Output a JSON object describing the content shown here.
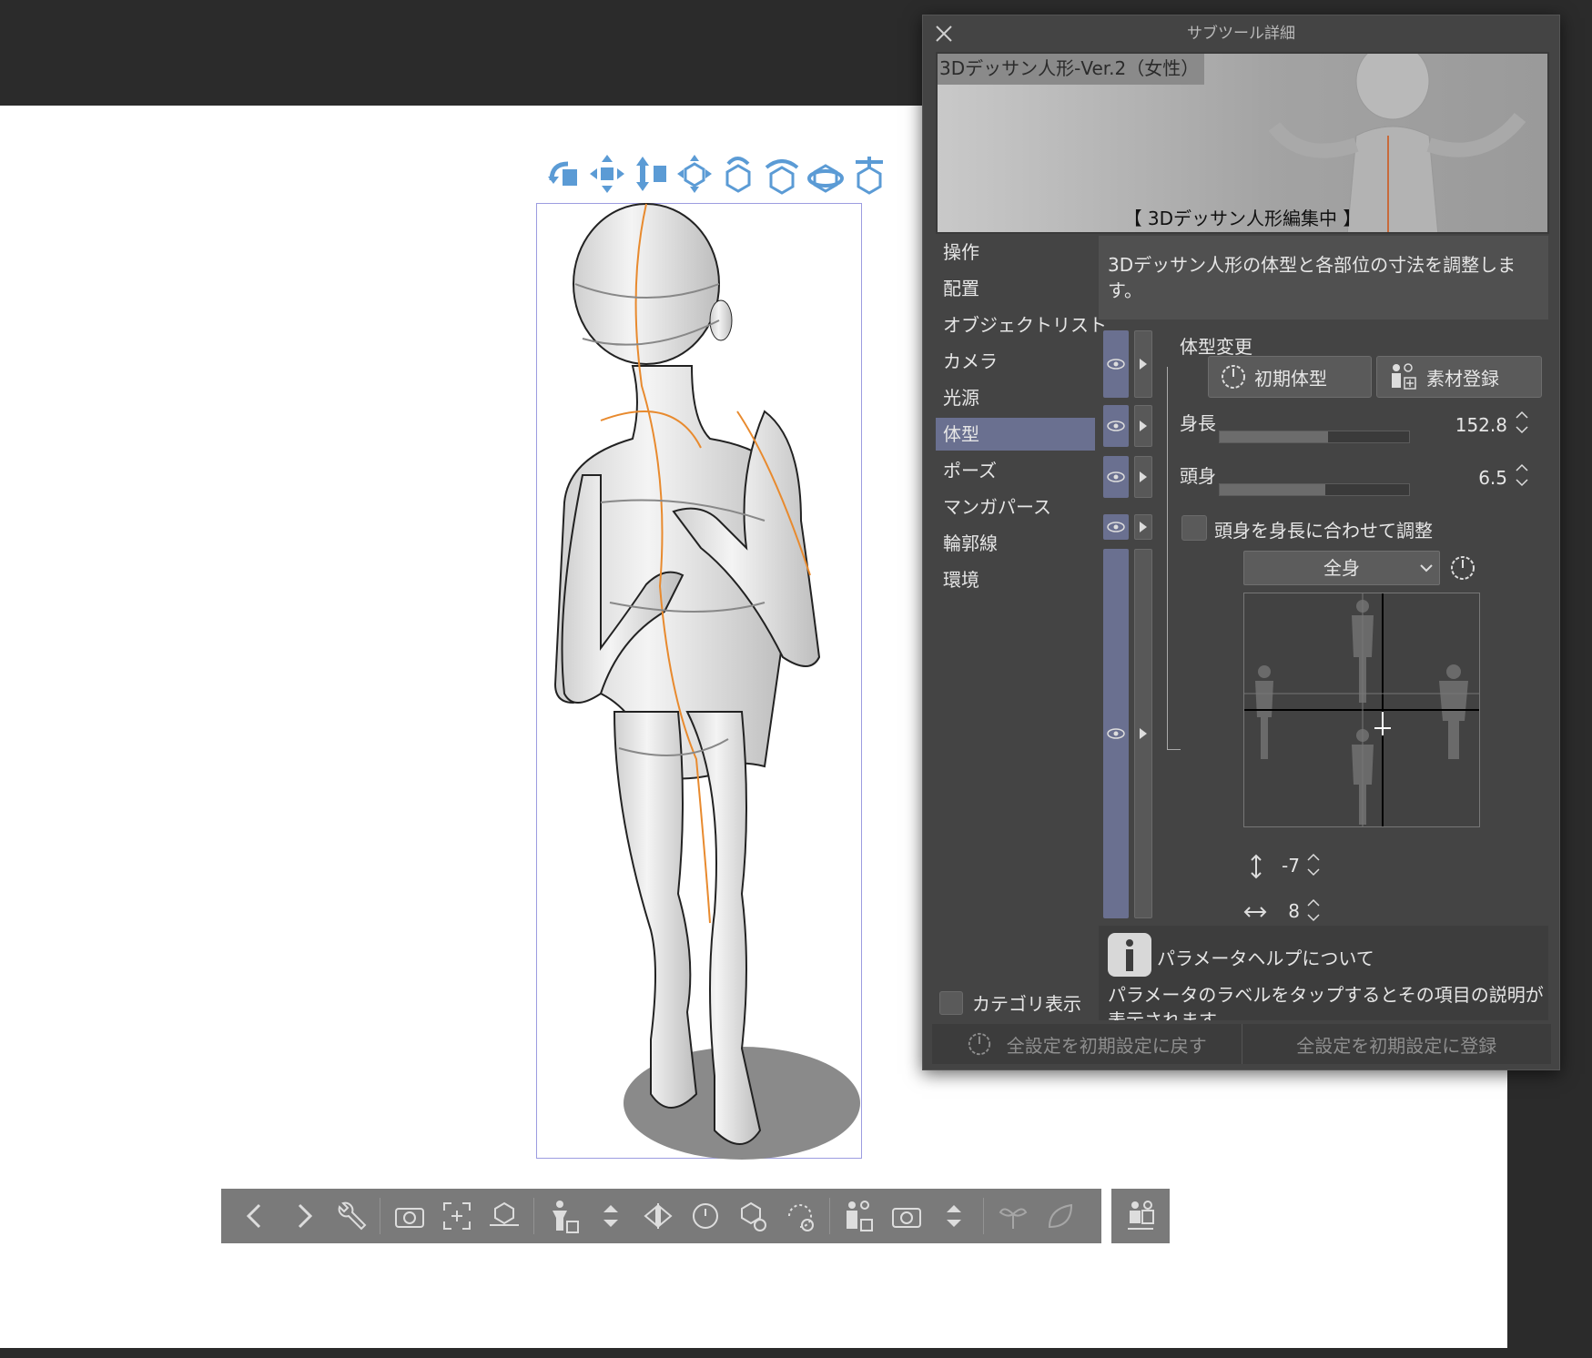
{
  "panel": {
    "title": "サブツール詳細",
    "preview": {
      "name": "3Dデッサン人形-Ver.2（女性）",
      "status": "【 3Dデッサン人形編集中 】"
    },
    "categories": [
      {
        "label": "操作"
      },
      {
        "label": "配置"
      },
      {
        "label": "オブジェクトリスト"
      },
      {
        "label": "カメラ"
      },
      {
        "label": "光源"
      },
      {
        "label": "体型",
        "active": true
      },
      {
        "label": "ポーズ"
      },
      {
        "label": "マンガパース"
      },
      {
        "label": "輪郭線"
      },
      {
        "label": "環境"
      }
    ],
    "category_toggle_label": "カテゴリ表示",
    "description": "3Dデッサン人形の体型と各部位の寸法を調整します。",
    "body_change": {
      "heading": "体型変更",
      "reset_button": "初期体型",
      "register_button": "素材登録"
    },
    "height": {
      "label": "身長",
      "value": "152.8",
      "fill": 0.57
    },
    "head_ratio": {
      "label": "頭身",
      "value": "6.5",
      "fill": 0.56
    },
    "adjust_head_checkbox": {
      "label": "頭身を身長に合わせて調整",
      "checked": false
    },
    "body_part_select": "全身",
    "grid_cursor": {
      "horizontal": 8,
      "vertical": -7
    },
    "vertical_value": "-7",
    "horizontal_value": "8",
    "help": {
      "title": "パラメータヘルプについて",
      "text": "パラメータのラベルをタップするとその項目の説明が表示されます。"
    },
    "footer": {
      "reset_all": "全設定を初期設定に戻す",
      "register_all": "全設定を初期設定に登録"
    }
  },
  "colors": {
    "accent_active": "#6a7090",
    "manipulator_blue": "#5b9bd5",
    "orange_guide": "#e88a2e"
  }
}
